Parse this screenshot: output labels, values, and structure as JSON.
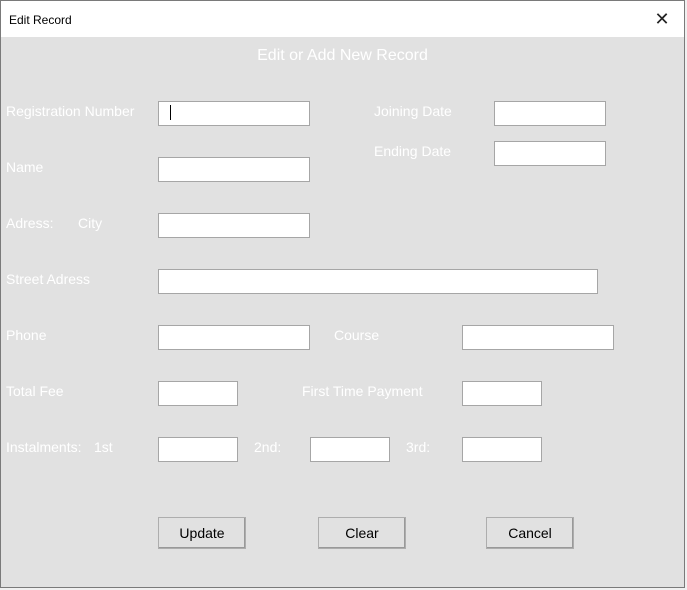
{
  "window": {
    "title": "Edit Record",
    "close_glyph": "✕"
  },
  "form": {
    "heading": "Edit or Add New Record",
    "labels": {
      "registration_number": "Registration Number",
      "joining_date": "Joining Date",
      "ending_date": "Ending Date",
      "name": "Name",
      "address": "Adress:",
      "city": "City",
      "street_address": "Street Adress",
      "phone": "Phone",
      "course": "Course",
      "total_fee": "Total Fee",
      "first_time_payment": "First Time Payment",
      "instalments": "Instalments:",
      "first": "1st",
      "second": "2nd:",
      "third": "3rd:"
    },
    "fields": {
      "registration_number": "",
      "joining_date": "",
      "ending_date": "",
      "name": "",
      "city": "",
      "street_address": "",
      "phone": "",
      "course": "",
      "total_fee": "",
      "first_time_payment": "",
      "instalment_1": "",
      "instalment_2": "",
      "instalment_3": ""
    },
    "buttons": {
      "update": "Update",
      "clear": "Clear",
      "cancel": "Cancel"
    }
  }
}
